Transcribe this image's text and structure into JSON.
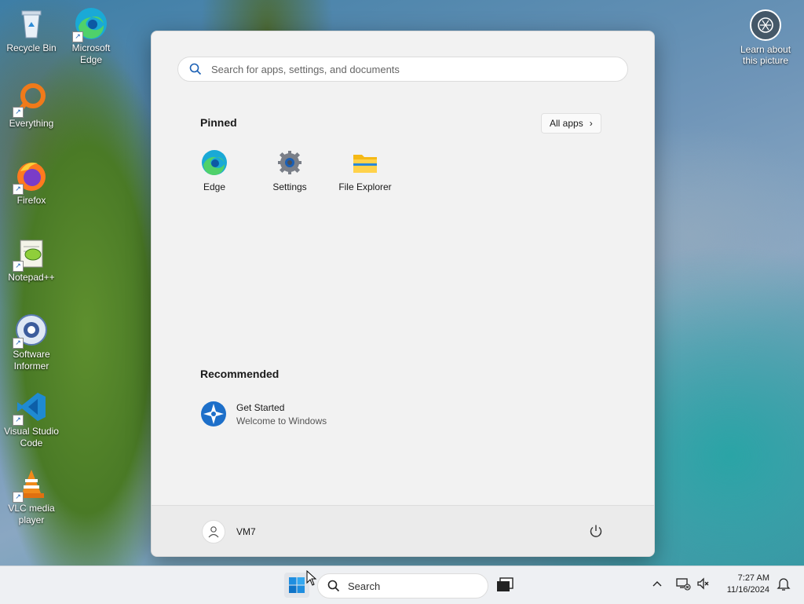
{
  "desktop": {
    "icons": [
      {
        "label": "Recycle Bin",
        "icon": "recycle-bin-icon"
      },
      {
        "label": "Microsoft Edge",
        "icon": "edge-icon"
      },
      {
        "label": "Everything",
        "icon": "everything-icon"
      },
      {
        "label": "Firefox",
        "icon": "firefox-icon"
      },
      {
        "label": "Notepad++",
        "icon": "notepad-plus-plus-icon"
      },
      {
        "label": "Software Informer",
        "icon": "software-informer-icon"
      },
      {
        "label": "Visual Studio Code",
        "icon": "vscode-icon"
      },
      {
        "label": "VLC media player",
        "icon": "vlc-icon"
      }
    ],
    "learn_about": {
      "label": "Learn about this picture",
      "icon": "camera-icon"
    }
  },
  "start_menu": {
    "search_placeholder": "Search for apps, settings, and documents",
    "pinned_title": "Pinned",
    "all_apps_label": "All apps",
    "pinned": [
      {
        "label": "Edge",
        "icon": "edge-icon"
      },
      {
        "label": "Settings",
        "icon": "settings-gear-icon"
      },
      {
        "label": "File Explorer",
        "icon": "folder-icon"
      }
    ],
    "recommended_title": "Recommended",
    "recommended": [
      {
        "title": "Get Started",
        "subtitle": "Welcome to Windows",
        "icon": "get-started-icon"
      }
    ],
    "user_name": "VM7"
  },
  "taskbar": {
    "search_label": "Search",
    "time": "7:27 AM",
    "date": "11/16/2024"
  },
  "colors": {
    "accent": "#0078d4",
    "taskbar_bg": "#eef0f3",
    "start_bg": "#f2f2f2"
  }
}
